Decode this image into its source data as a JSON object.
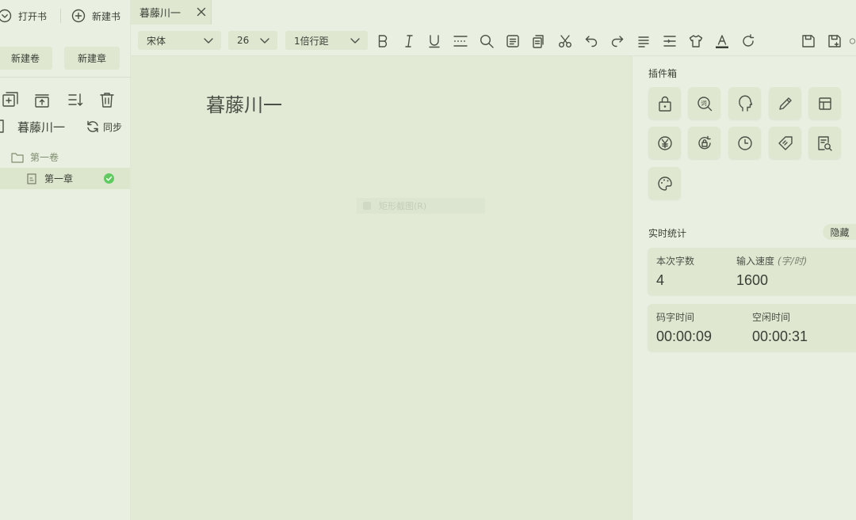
{
  "sidebar": {
    "open_book_label": "打开书",
    "new_book_label": "新建书",
    "new_volume_label": "新建卷",
    "new_chapter_label": "新建章",
    "book_title": "暮藤川一",
    "sync_label": "同步",
    "tree": {
      "volume_label": "第一卷",
      "chapter_label": "第一章"
    }
  },
  "tabs": [
    {
      "label": "暮藤川一"
    }
  ],
  "toolbar": {
    "font_family": "宋体",
    "font_size": "26",
    "line_spacing": "1倍行距"
  },
  "editor": {
    "title": "暮藤川一",
    "ghost_menu_label": "矩形截图(R)"
  },
  "plugins": {
    "title": "插件箱"
  },
  "stats": {
    "title": "实时统计",
    "hide_label": "隐藏",
    "this_count_label": "本次字数",
    "this_count_value": "4",
    "speed_label": "输入速度",
    "speed_unit": "(字/时)",
    "speed_value": "1600",
    "typing_time_label": "码字时间",
    "typing_time_value": "00:00:09",
    "idle_time_label": "空闲时间",
    "idle_time_value": "00:00:31"
  },
  "colors": {
    "background": "#eaf0e1",
    "editor": "#e2e9d5",
    "button": "#dfe7d1",
    "status_ok": "#5ecb5e"
  }
}
